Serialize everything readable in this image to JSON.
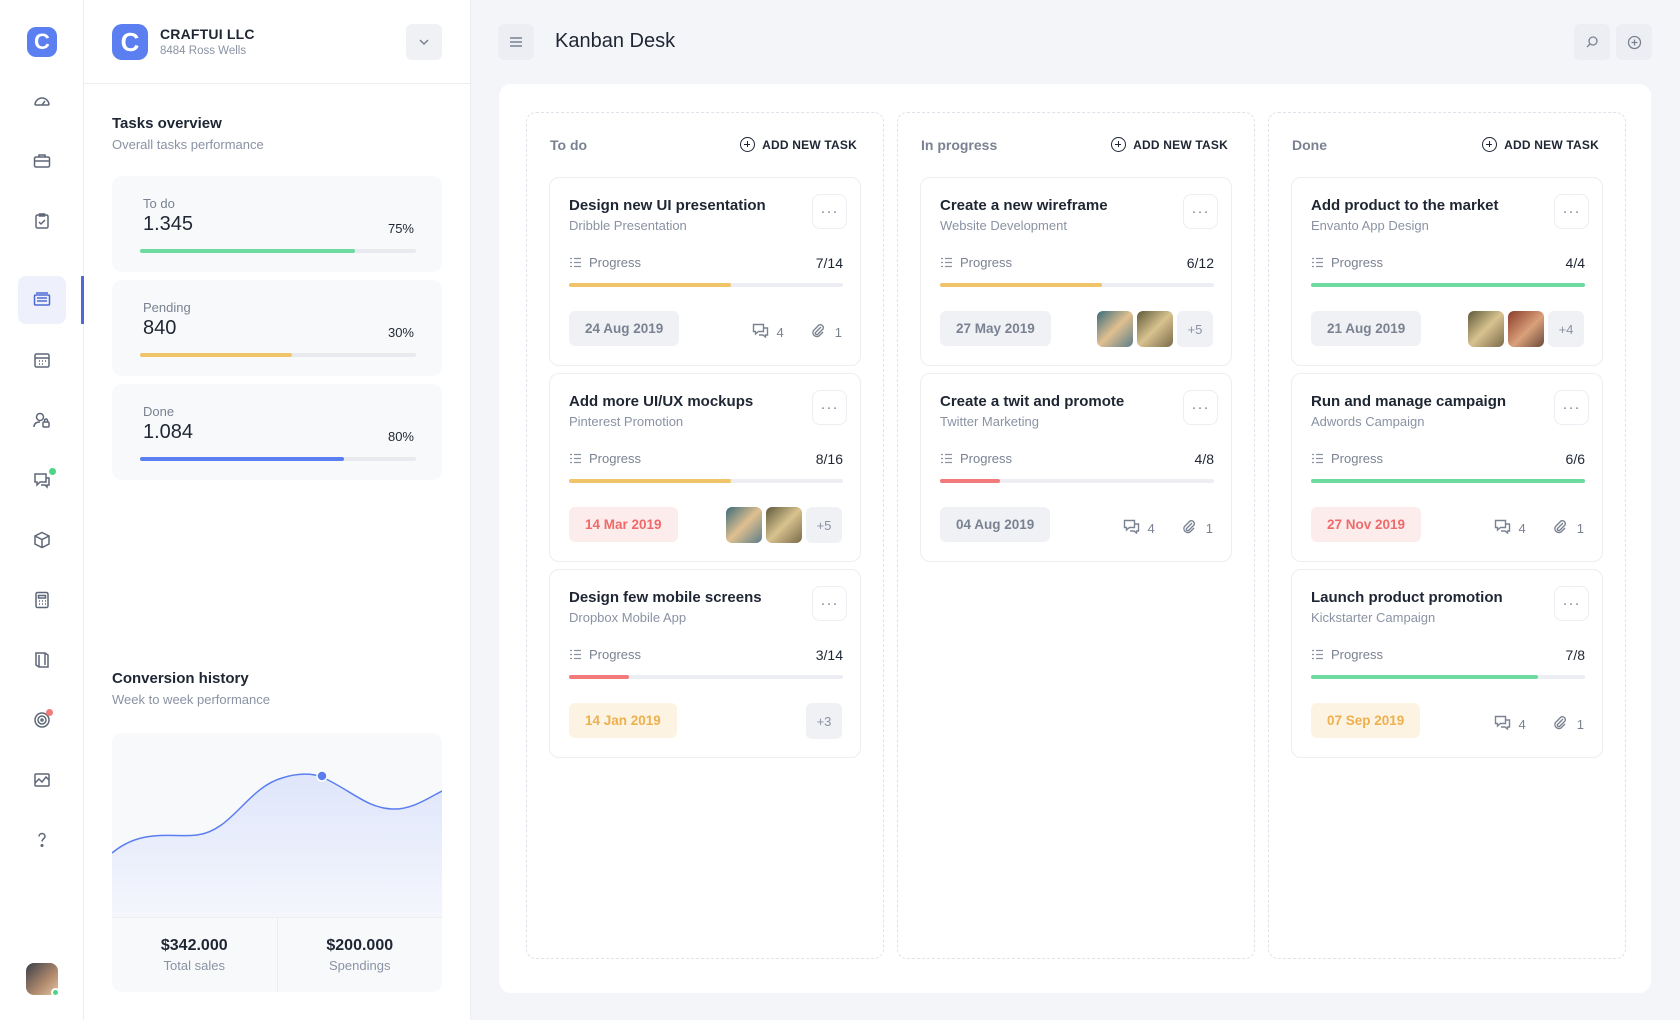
{
  "brand": {
    "letter": "C",
    "name": "CRAFTUI LLC",
    "address": "8484 Ross Wells"
  },
  "page": {
    "title": "Kanban Desk"
  },
  "tasks_overview": {
    "title": "Tasks overview",
    "subtitle": "Overall tasks performance",
    "stats": [
      {
        "label": "To do",
        "value": "1.345",
        "percent": "75%",
        "fill": 0.78,
        "color": "#6ddba0"
      },
      {
        "label": "Pending",
        "value": "840",
        "percent": "30%",
        "fill": 0.55,
        "color": "#f0c56a"
      },
      {
        "label": "Done",
        "value": "1.084",
        "percent": "80%",
        "fill": 0.74,
        "color": "#5b7ef0"
      }
    ]
  },
  "conversion": {
    "title": "Conversion history",
    "subtitle": "Week to week performance",
    "total_sales_value": "$342.000",
    "total_sales_label": "Total sales",
    "spendings_value": "$200.000",
    "spendings_label": "Spendings"
  },
  "columns": [
    {
      "title": "To do",
      "add_label": "ADD NEW TASK",
      "cards": [
        {
          "title": "Design new UI presentation",
          "subtitle": "Dribble Presentation",
          "progress_label": "Progress",
          "progress": "7/14",
          "fill": 0.59,
          "bar_color": "#f0c56a",
          "date": "24 Aug 2019",
          "date_style": "gray",
          "comments": "4",
          "attachments": "1"
        },
        {
          "title": "Add more UI/UX mockups",
          "subtitle": "Pinterest Promotion",
          "progress_label": "Progress",
          "progress": "8/16",
          "fill": 0.59,
          "bar_color": "#f0c56a",
          "date": "14 Mar 2019",
          "date_style": "red",
          "extra_members": "+5"
        },
        {
          "title": "Design few mobile screens",
          "subtitle": "Dropbox Mobile App",
          "progress_label": "Progress",
          "progress": "3/14",
          "fill": 0.22,
          "bar_color": "#f27a7a",
          "date": "14 Jan 2019",
          "date_style": "orange",
          "extra_members": "+3"
        }
      ]
    },
    {
      "title": "In progress",
      "add_label": "ADD NEW TASK",
      "cards": [
        {
          "title": "Create a new wireframe",
          "subtitle": "Website Development",
          "progress_label": "Progress",
          "progress": "6/12",
          "fill": 0.59,
          "bar_color": "#f0c56a",
          "date": "27 May 2019",
          "date_style": "gray",
          "extra_members": "+5"
        },
        {
          "title": "Create a twit and promote",
          "subtitle": "Twitter Marketing",
          "progress_label": "Progress",
          "progress": "4/8",
          "fill": 0.22,
          "bar_color": "#f27a7a",
          "date": "04 Aug 2019",
          "date_style": "gray",
          "comments": "4",
          "attachments": "1"
        }
      ]
    },
    {
      "title": "Done",
      "add_label": "ADD NEW TASK",
      "cards": [
        {
          "title": "Add product to the market",
          "subtitle": "Envanto App Design",
          "progress_label": "Progress",
          "progress": "4/4",
          "fill": 1.0,
          "bar_color": "#6ddba0",
          "date": "21 Aug 2019",
          "date_style": "gray",
          "extra_members": "+4"
        },
        {
          "title": "Run and manage campaign",
          "subtitle": "Adwords Campaign",
          "progress_label": "Progress",
          "progress": "6/6",
          "fill": 1.0,
          "bar_color": "#6ddba0",
          "date": "27 Nov 2019",
          "date_style": "red",
          "comments": "4",
          "attachments": "1"
        },
        {
          "title": "Launch product promotion",
          "subtitle": "Kickstarter Campaign",
          "progress_label": "Progress",
          "progress": "7/8",
          "fill": 0.83,
          "bar_color": "#6ddba0",
          "date": "07 Sep 2019",
          "date_style": "orange",
          "comments": "4",
          "attachments": "1"
        }
      ]
    }
  ],
  "colors": {
    "accent": "#5b7ef0",
    "green": "#6ddba0",
    "yellow": "#f0c56a",
    "red": "#f27a7a"
  }
}
